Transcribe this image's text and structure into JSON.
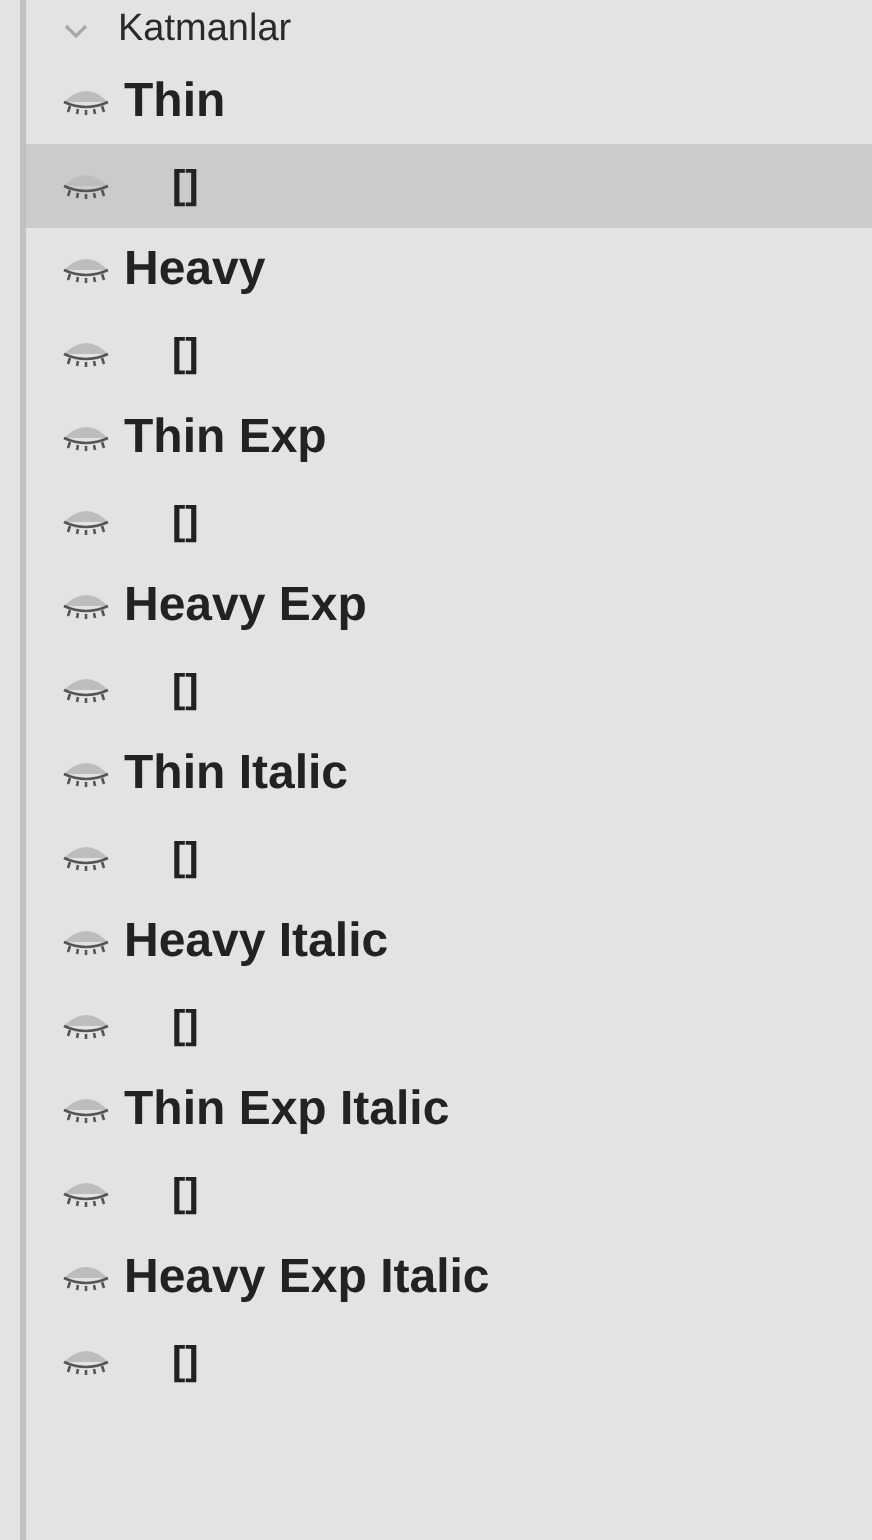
{
  "panel": {
    "title": "Katmanlar",
    "expanded": true,
    "layers": [
      {
        "name": "Thin",
        "selected": false,
        "children": [
          {
            "name": "[]",
            "selected": true
          }
        ]
      },
      {
        "name": "Heavy",
        "selected": false,
        "children": [
          {
            "name": "[]",
            "selected": false
          }
        ]
      },
      {
        "name": "Thin Exp",
        "selected": false,
        "children": [
          {
            "name": "[]",
            "selected": false
          }
        ]
      },
      {
        "name": "Heavy Exp",
        "selected": false,
        "children": [
          {
            "name": "[]",
            "selected": false
          }
        ]
      },
      {
        "name": "Thin Italic",
        "selected": false,
        "children": [
          {
            "name": "[]",
            "selected": false
          }
        ]
      },
      {
        "name": "Heavy Italic",
        "selected": false,
        "children": [
          {
            "name": "[]",
            "selected": false
          }
        ]
      },
      {
        "name": "Thin Exp Italic",
        "selected": false,
        "children": [
          {
            "name": "[]",
            "selected": false
          }
        ]
      },
      {
        "name": "Heavy Exp Italic",
        "selected": false,
        "children": [
          {
            "name": "[]",
            "selected": false
          }
        ]
      }
    ]
  }
}
